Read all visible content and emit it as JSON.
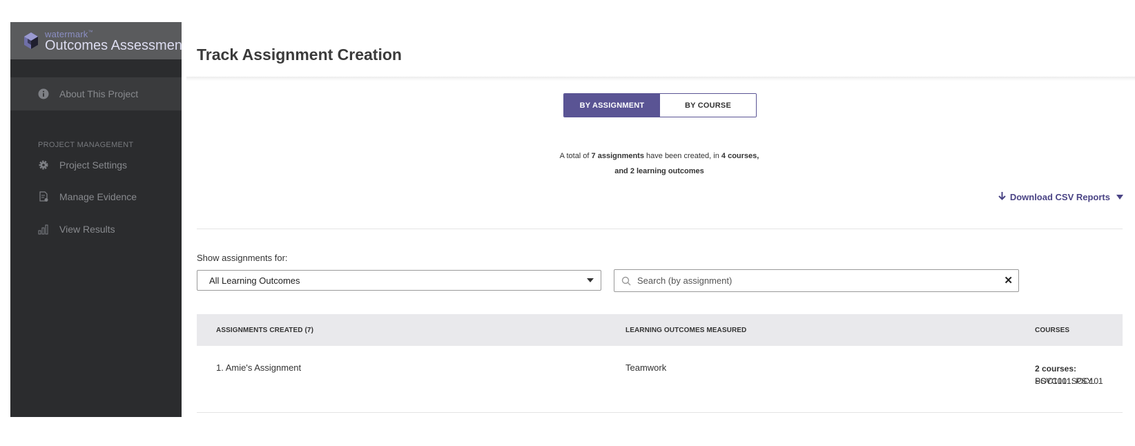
{
  "sidebar": {
    "brand_sub": "watermark",
    "brand_title": "Outcomes Assessment",
    "items": [
      {
        "label": "About This Project",
        "icon": "info-icon"
      },
      {
        "label": "Project Settings",
        "icon": "gear-icon"
      },
      {
        "label": "Manage Evidence",
        "icon": "document-icon"
      },
      {
        "label": "View Results",
        "icon": "bar-chart-icon"
      }
    ],
    "section_label": "PROJECT MANAGEMENT"
  },
  "main": {
    "title": "Track Assignment Creation",
    "toggle": {
      "by_assignment": "BY ASSIGNMENT",
      "by_course": "BY COURSE"
    },
    "summary": {
      "prefix": "A total of",
      "assignments": "7 assignments",
      "middle": "have been created, in",
      "courses": "4 courses,",
      "outcomes": "and 2 learning outcomes"
    },
    "download_label": "Download CSV Reports",
    "filter_label": "Show assignments for:",
    "filter_value": "All Learning Outcomes",
    "search_placeholder": "Search (by assignment)",
    "table": {
      "headers": [
        "ASSIGNMENTS CREATED (7)",
        "LEARNING OUTCOMES MEASURED",
        "COURSES"
      ],
      "rows": [
        {
          "assignment": "1. Amie's Assignment",
          "outcome": "Teamwork",
          "course_count": "2 courses:",
          "courses": [
            "PSYC101: PSYC101",
            "SOC101: SOC101"
          ]
        }
      ]
    }
  },
  "colors": {
    "accent": "#5a5494",
    "sidebar": "#2b2c2e"
  }
}
